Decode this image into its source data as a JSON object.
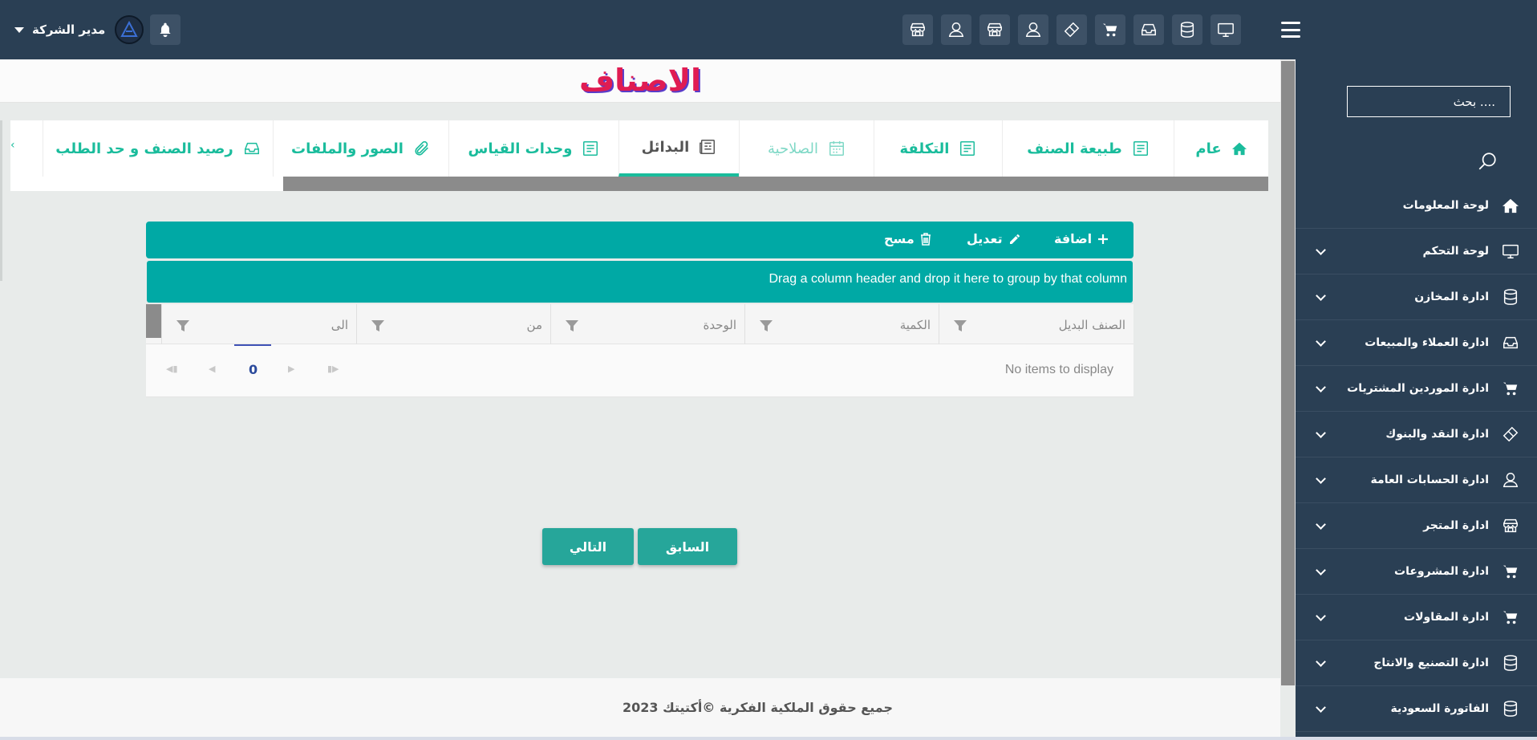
{
  "header": {
    "user_name": "مدير الشركة",
    "quick_icons": [
      "store-icon",
      "user-icon",
      "store-icon",
      "user-icon",
      "ticket-icon",
      "cart-icon",
      "inbox-icon",
      "database-icon",
      "monitor-icon"
    ]
  },
  "sidebar": {
    "search_placeholder": "بحث ....",
    "items": [
      {
        "label": "لوحة المعلومات",
        "icon": "home-icon",
        "expandable": false
      },
      {
        "label": "لوحة التحكم",
        "icon": "monitor-icon",
        "expandable": true
      },
      {
        "label": "ادارة المخازن",
        "icon": "database-icon",
        "expandable": true
      },
      {
        "label": "ادارة العملاء والمبيعات",
        "icon": "inbox-icon",
        "expandable": true
      },
      {
        "label": "ادارة الموردين المشتريات",
        "icon": "cart-icon",
        "expandable": true
      },
      {
        "label": "ادارة النقد والبنوك",
        "icon": "ticket-icon",
        "expandable": true
      },
      {
        "label": "ادارة الحسابات العامة",
        "icon": "user-icon",
        "expandable": true
      },
      {
        "label": "ادارة المتجر",
        "icon": "store-icon",
        "expandable": true
      },
      {
        "label": "ادارة المشروعات",
        "icon": "cart-icon",
        "expandable": true
      },
      {
        "label": "ادارة المقاولات",
        "icon": "cart-icon",
        "expandable": true
      },
      {
        "label": "ادارة التصنيع والانتاج",
        "icon": "database-icon",
        "expandable": true
      },
      {
        "label": "الفاتورة السعودية",
        "icon": "database-icon",
        "expandable": true
      }
    ]
  },
  "page": {
    "title": "الاصناف"
  },
  "tabs": [
    {
      "label": "عام",
      "icon": "home-icon",
      "state": "normal"
    },
    {
      "label": "طبيعة الصنف",
      "icon": "document-icon",
      "state": "normal"
    },
    {
      "label": "التكلفة",
      "icon": "document-icon",
      "state": "normal"
    },
    {
      "label": "الصلاحية",
      "icon": "calendar-icon",
      "state": "disabled"
    },
    {
      "label": "البدائل",
      "icon": "newspaper-icon",
      "state": "active"
    },
    {
      "label": "وحدات القياس",
      "icon": "document-icon",
      "state": "normal"
    },
    {
      "label": "الصور والملفات",
      "icon": "paperclip-icon",
      "state": "normal"
    },
    {
      "label": "رصيد الصنف و حد الطلب",
      "icon": "inbox-icon",
      "state": "normal"
    }
  ],
  "toolbar": {
    "add_label": "اضافة",
    "edit_label": "تعديل",
    "delete_label": "مسح"
  },
  "grid": {
    "group_hint": "Drag a column header and drop it here to group by that column",
    "columns": [
      "الصنف البديل",
      "الكمية",
      "الوحدة",
      "من",
      "الى"
    ],
    "empty_text": "No items to display",
    "page_number": "0"
  },
  "nav": {
    "prev_label": "السابق",
    "next_label": "التالي"
  },
  "footer": {
    "text": "جميع حقوق الملكية الفكرية ©أكتيتك 2023"
  },
  "colors": {
    "sidebar": "#2a3f54",
    "accent": "#1abc9c",
    "grid_bar": "#00a9a5",
    "title": "#e01c52"
  }
}
